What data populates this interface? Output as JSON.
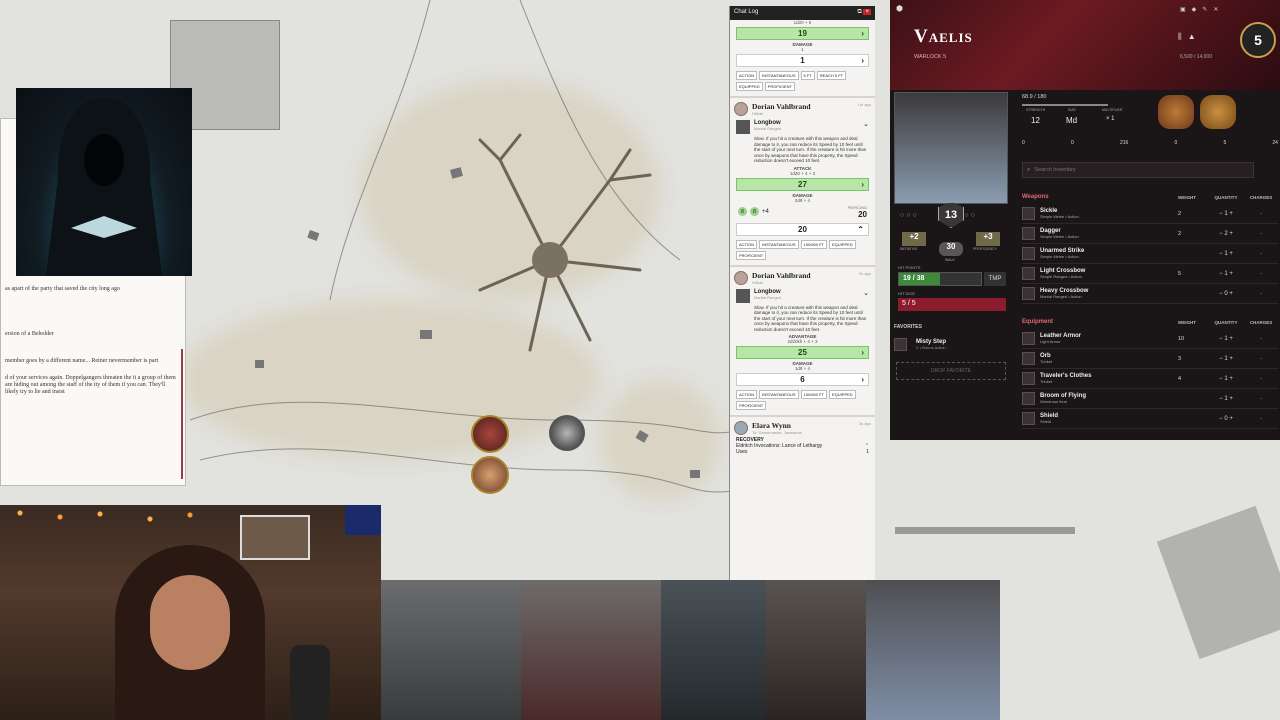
{
  "chat": {
    "title": "Chat Log",
    "top_roll": {
      "formula": "1d20 + 5",
      "total": "19",
      "damage_label": "DAMAGE",
      "damage_formula": "1",
      "damage_total": "1",
      "tags": [
        "ACTION",
        "INSTANTANEOUS",
        "5 FT",
        "REACH 5 FT",
        "EQUIPPED",
        "PROFICIENT"
      ]
    },
    "entries": [
      {
        "speaker": "Dorian Vahlbrand",
        "subtitle": "Hitball",
        "time": "1m ago",
        "item_name": "Longbow",
        "item_type": "Martial Ranged",
        "description": "Slow. If you hit a creature with this weapon and deal damage to it, you can reduce its Speed by 10 feet until the start of your next turn. If the creature is hit more than once by weapons that have this property, the Speed reduction doesn't exceed 10 feet.",
        "attack_label": "ATTACK",
        "attack_formula": "1d20 + 4 + 3",
        "attack_total": "27",
        "damage_label": "DAMAGE",
        "damage_formula": "2d8 + 4",
        "dice": [
          "8",
          "8"
        ],
        "dice_mod": "+4",
        "damage_type": "PIERCING",
        "damage_total": "20",
        "damage_row": "20",
        "tags": [
          "ACTION",
          "INSTANTANEOUS",
          "150/600 FT",
          "EQUIPPED",
          "PROFICIENT"
        ]
      },
      {
        "speaker": "Dorian Vahlbrand",
        "subtitle": "Hitball",
        "time": "3s ago",
        "item_name": "Longbow",
        "item_type": "Martial Ranged",
        "description": "Slow. If you hit a creature with this weapon and deal damage to it, you can reduce its Speed by 10 feet until the start of your next turn. If the creature is hit more than once by weapons that have this property, the Speed reduction doesn't exceed 10 feet.",
        "attack_label": "ADVANTAGE",
        "attack_formula": "2d20kh + 4 + 3",
        "attack_total": "25",
        "damage_label": "DAMAGE",
        "damage_formula": "1d8 + 4",
        "damage_total": "6",
        "tags": [
          "ACTION",
          "INSTANTANEOUS",
          "150/600 FT",
          "EQUIPPED",
          "PROFICIENT"
        ]
      },
      {
        "speaker": "Elara Wynn",
        "subtitle": "To: Gamemaster, Jasmanos",
        "time": "3s ago",
        "section": "RECOVERY",
        "line": "Eldritch Invocations: Lance of Lethargy",
        "uses_label": "Uses",
        "uses_value": "1"
      }
    ]
  },
  "sheet": {
    "name": "Vaelis",
    "class_level": "WARLOCK 5",
    "level_badge": "5",
    "xp": "6,500 / 14,000",
    "ac": "13",
    "initiative": "+2",
    "initiative_label": "INITIATIVE",
    "walk": "30",
    "walk_label": "WALK",
    "proficiency": "+3",
    "proficiency_label": "PROFICIENCY",
    "hp_label": "HIT POINTS",
    "hp": "19 / 38",
    "hp_fraction": 0.5,
    "tmp": "TMP",
    "hit_dice_label": "HIT DICE",
    "hit_dice": "5 / 5",
    "weight": "68.9 / 180",
    "strength_label": "STRENGTH",
    "strength": "12",
    "size_label": "SIZE",
    "size": "Md",
    "multiplier_label": "MULTIPLIER",
    "multiplier": "× 1",
    "currency": [
      "0",
      "0",
      "216",
      "0",
      "5",
      "24"
    ],
    "search_placeholder": "Search inventory",
    "favorites_label": "FAVORITES",
    "favorite": {
      "name": "Misty Step",
      "type": "V • Bonus Action"
    },
    "drop_favorite": "DROP FAVORITE",
    "columns": [
      "WEIGHT",
      "QUANTITY",
      "CHARGES"
    ],
    "weapons_label": "Weapons",
    "weapons": [
      {
        "name": "Sickle",
        "type": "Simple Melee • Action",
        "weight": "2",
        "qty": "1"
      },
      {
        "name": "Dagger",
        "type": "Simple Melee • Action",
        "weight": "2",
        "qty": "2"
      },
      {
        "name": "Unarmed Strike",
        "type": "Simple Melee • Action",
        "weight": "",
        "qty": "1"
      },
      {
        "name": "Light Crossbow",
        "type": "Simple Ranged • Action",
        "weight": "5",
        "qty": "1"
      },
      {
        "name": "Heavy Crossbow",
        "type": "Martial Ranged • Action",
        "weight": "",
        "qty": "0"
      }
    ],
    "equipment_label": "Equipment",
    "equipment": [
      {
        "name": "Leather Armor",
        "type": "Light Armor",
        "weight": "10",
        "qty": "1"
      },
      {
        "name": "Orb",
        "type": "Trinket",
        "weight": "3",
        "qty": "1"
      },
      {
        "name": "Traveler's Clothes",
        "type": "Trinket",
        "weight": "4",
        "qty": "1"
      },
      {
        "name": "Broom of Flying",
        "type": "Wondrous Item",
        "weight": "",
        "qty": "1"
      },
      {
        "name": "Shield",
        "type": "Shield",
        "weight": "",
        "qty": "0"
      }
    ]
  },
  "handout": {
    "lines": [
      "as apart of the party that saved the city long ago",
      "ersion of a Beholder",
      "member goes by a different name... Reiner nevermember is part",
      "d of your services again. Doppelgangers threaten the it a group of them are hiding out among the staff of the ity of them if you can. They'll likely try to lie and insist"
    ]
  },
  "colors": {
    "accent": "#7a1a24",
    "green": "#b8e6a8"
  }
}
